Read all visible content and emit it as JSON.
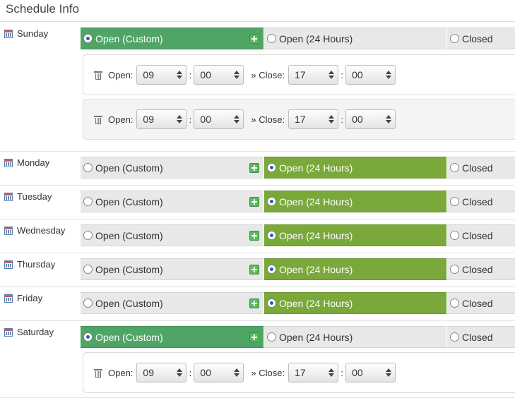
{
  "header": {
    "title": "Schedule Info"
  },
  "options": {
    "custom": "Open (Custom)",
    "h24": "Open (24 Hours)",
    "closed": "Closed"
  },
  "slot_labels": {
    "open": "Open:",
    "close": "» Close:",
    "sep": ":"
  },
  "colors": {
    "custom_active": "#4fa566",
    "h24_active": "#7aa83a",
    "inactive": "#e8e8e8"
  },
  "days": [
    {
      "name": "Sunday",
      "selected": "custom",
      "slots": [
        {
          "open_h": "09",
          "open_m": "00",
          "close_h": "17",
          "close_m": "00"
        },
        {
          "open_h": "09",
          "open_m": "00",
          "close_h": "17",
          "close_m": "00"
        }
      ]
    },
    {
      "name": "Monday",
      "selected": "h24",
      "slots": []
    },
    {
      "name": "Tuesday",
      "selected": "h24",
      "slots": []
    },
    {
      "name": "Wednesday",
      "selected": "h24",
      "slots": []
    },
    {
      "name": "Thursday",
      "selected": "h24",
      "slots": []
    },
    {
      "name": "Friday",
      "selected": "h24",
      "slots": []
    },
    {
      "name": "Saturday",
      "selected": "custom",
      "slots": [
        {
          "open_h": "09",
          "open_m": "00",
          "close_h": "17",
          "close_m": "00"
        }
      ]
    }
  ]
}
